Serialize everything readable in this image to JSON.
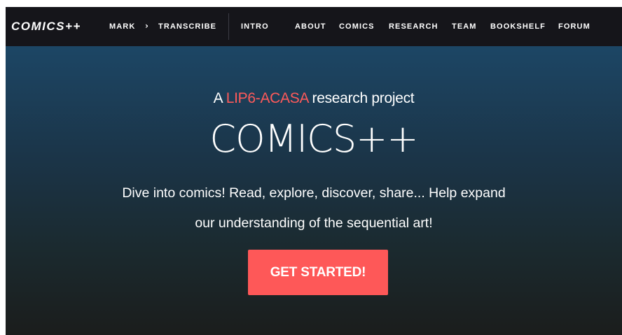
{
  "navbar": {
    "brand": "COMICS++",
    "mark_label": "MARK",
    "separator": "›",
    "transcribe_label": "TRANSCRIBE",
    "links": [
      {
        "label": "INTRO"
      },
      {
        "label": "ABOUT"
      },
      {
        "label": "COMICS"
      },
      {
        "label": "RESEARCH"
      },
      {
        "label": "TEAM"
      },
      {
        "label": "BOOKSHELF"
      },
      {
        "label": "FORUM"
      }
    ]
  },
  "hero": {
    "tagline_prefix": "A ",
    "tagline_highlight": "LIP6-ACASA",
    "tagline_suffix": " research project",
    "title": "COMICS++",
    "description_line1": "Dive into comics! Read, explore, discover, share... Help expand",
    "description_line2": "our understanding of the sequential art!",
    "cta_label": "GET STARTED!"
  },
  "colors": {
    "navbar_bg": "#15151a",
    "accent": "#fe5858",
    "hero_top": "#1c4665",
    "hero_bottom": "#1b1d1c"
  },
  "icons": {
    "separator_icon": "chevron-right-icon"
  }
}
